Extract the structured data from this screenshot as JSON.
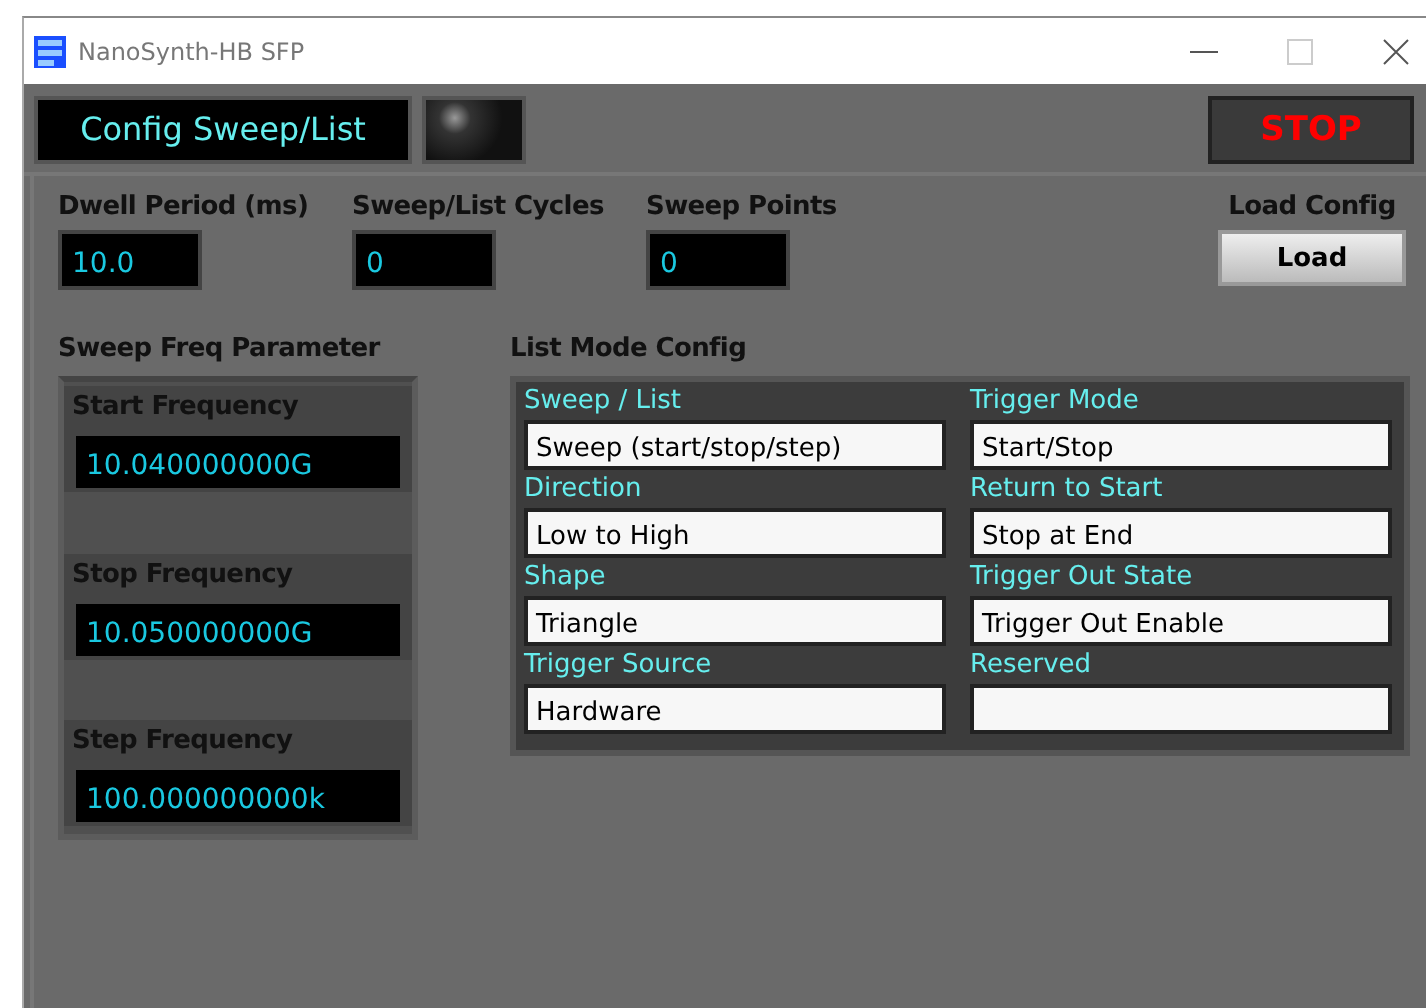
{
  "window": {
    "title": "NanoSynth-HB SFP"
  },
  "header": {
    "title": "Config Sweep/List",
    "indicator": {
      "on": false
    },
    "stop_button": "STOP"
  },
  "top_fields": [
    {
      "label": "Dwell Period (ms)",
      "value": "10.0"
    },
    {
      "label": "Sweep/List Cycles",
      "value": "0"
    },
    {
      "label": "Sweep Points",
      "value": "0"
    }
  ],
  "load_config": {
    "label": "Load Config",
    "button": "Load"
  },
  "sweep_freq": {
    "title": "Sweep Freq Parameter",
    "items": [
      {
        "label": "Start Frequency",
        "value": "10.040000000G"
      },
      {
        "label": "Stop Frequency",
        "value": "10.050000000G"
      },
      {
        "label": "Step Frequency",
        "value": "100.000000000k"
      }
    ]
  },
  "list_mode": {
    "title": "List Mode Config",
    "items": [
      {
        "label": "Sweep / List",
        "value": "Sweep (start/stop/step)"
      },
      {
        "label": "Trigger Mode",
        "value": "Start/Stop"
      },
      {
        "label": "Direction",
        "value": "Low to High"
      },
      {
        "label": "Return to Start",
        "value": "Stop at End"
      },
      {
        "label": "Shape",
        "value": "Triangle"
      },
      {
        "label": "Trigger Out State",
        "value": "Trigger Out Enable"
      },
      {
        "label": "Trigger Source",
        "value": "Hardware"
      },
      {
        "label": "Reserved",
        "value": ""
      }
    ]
  }
}
